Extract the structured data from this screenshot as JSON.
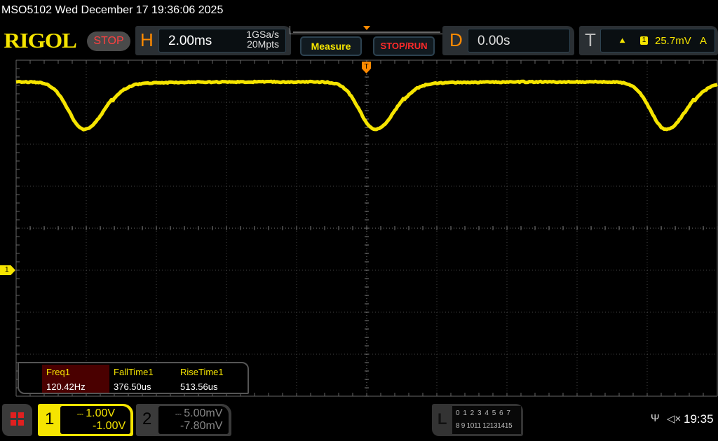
{
  "title": "MSO5102  Wed December 17 19:36:06 2025",
  "logo": "RIGOL",
  "run_state": "STOP",
  "horizontal": {
    "label": "H",
    "timebase": "2.00ms",
    "sample_rate": "1GSa/s",
    "memory_depth": "20Mpts"
  },
  "buttons": {
    "measure": "Measure",
    "stop_run": "STOP/RUN"
  },
  "delay": {
    "label": "D",
    "value": "0.00s"
  },
  "trigger": {
    "label": "T",
    "edge_icon": "rising-edge-icon",
    "edge_glyph": "⯅",
    "source": "1",
    "level": "25.7mV",
    "mode": "A"
  },
  "trigger_marker": "T",
  "channel1_marker": "1",
  "measurements": [
    {
      "label": "Freq1",
      "value": "120.42Hz"
    },
    {
      "label": "FallTime1",
      "value": "376.50us"
    },
    {
      "label": "RiseTime1",
      "value": "513.56us"
    }
  ],
  "channels": [
    {
      "number": "1",
      "coupling": "⎓",
      "scale": "1.00V",
      "offset": "-1.00V",
      "color": "#f5e400",
      "active": true
    },
    {
      "number": "2",
      "coupling": "⎓",
      "scale": "5.00mV",
      "offset": "-7.80mV",
      "color": "#888888",
      "active": false
    }
  ],
  "logic": {
    "label": "L",
    "row1": "0 1 2 3  4 5 6 7",
    "row2": "8 9 1011 12131415"
  },
  "status": {
    "usb_icon": "⚲",
    "speaker_icon": "🔇",
    "clock": "19:35"
  },
  "colors": {
    "trace": "#f5e400",
    "accent": "#ff8a00",
    "grid": "#555555"
  }
}
